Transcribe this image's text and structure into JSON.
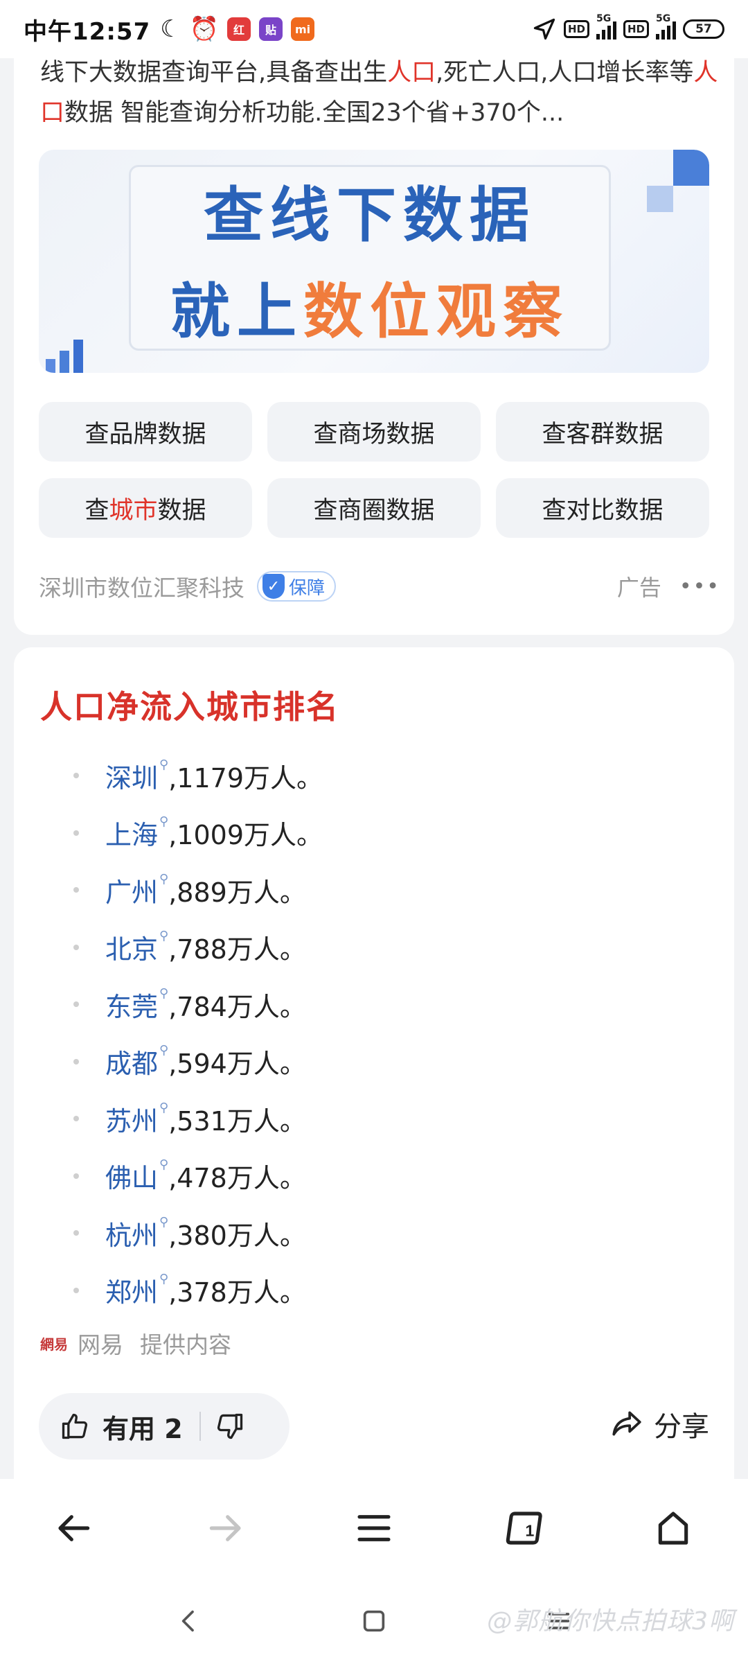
{
  "status_bar": {
    "time": "中午12:57",
    "battery": "57",
    "network_label_1": "5G",
    "network_label_2": "5G",
    "hd_1": "HD",
    "hd_2": "HD",
    "app_badges": [
      "红",
      "贴",
      "mi"
    ]
  },
  "ad": {
    "description_parts": {
      "p1": "线下大数据查询平台,具备查出生",
      "h1": "人口",
      "p2": ",死亡人口,人口增长率等",
      "h2": "人口",
      "p3": "数据 智能查询分析功能.全国23个省+370个..."
    },
    "banner": {
      "line1": "查线下数据",
      "line2_prefix": "就上",
      "line2_highlight": "数位观察"
    },
    "buttons": [
      {
        "label": "查品牌数据"
      },
      {
        "label": "查商场数据"
      },
      {
        "label": "查客群数据"
      },
      {
        "prefix": "查",
        "highlight": "城市",
        "suffix": "数据"
      },
      {
        "label": "查商圈数据"
      },
      {
        "label": "查对比数据"
      }
    ],
    "advertiser": "深圳市数位汇聚科技",
    "guarantee": "保障",
    "ad_label": "广告",
    "more": "•••"
  },
  "content": {
    "title": "人口净流入城市排名",
    "rankings": [
      {
        "city": "深圳",
        "value": ",1179万人。"
      },
      {
        "city": "上海",
        "value": ",1009万人。"
      },
      {
        "city": "广州",
        "value": ",889万人。"
      },
      {
        "city": "北京",
        "value": ",788万人。"
      },
      {
        "city": "东莞",
        "value": ",784万人。"
      },
      {
        "city": "成都",
        "value": ",594万人。"
      },
      {
        "city": "苏州",
        "value": ",531万人。"
      },
      {
        "city": "佛山",
        "value": ",478万人。"
      },
      {
        "city": "杭州",
        "value": ",380万人。"
      },
      {
        "city": "郑州",
        "value": ",378万人。"
      }
    ],
    "source_logo": "網易",
    "source_name": "网易",
    "source_note": "提供内容",
    "useful_label": "有用 2",
    "share_label": "分享"
  },
  "watermark": "@郭航你快点拍球3啊",
  "colors": {
    "accent_red": "#d8322a",
    "link_blue": "#2b5fb0",
    "banner_blue": "#2a63b9",
    "banner_orange": "#f07c3c"
  }
}
